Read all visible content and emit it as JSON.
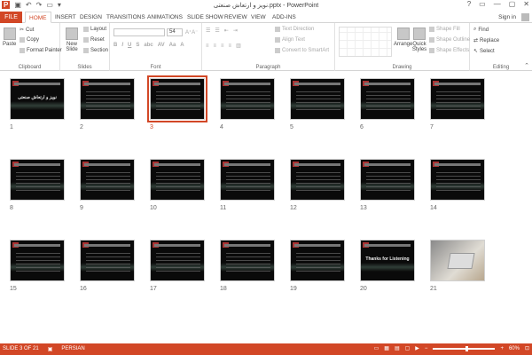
{
  "window": {
    "title": "نویز و ارتعاش صنعتی.pptx - PowerPoint",
    "controls": [
      "?",
      "▭",
      "—",
      "▢",
      "✕"
    ]
  },
  "tabs": {
    "file": "FILE",
    "items": [
      "HOME",
      "INSERT",
      "DESIGN",
      "TRANSITIONS",
      "ANIMATIONS",
      "SLIDE SHOW",
      "REVIEW",
      "VIEW",
      "ADD-INS"
    ],
    "active": "HOME",
    "signin": "Sign in"
  },
  "ribbon": {
    "clipboard": {
      "paste": "Paste",
      "cut": "Cut",
      "copy": "Copy",
      "format_painter": "Format Painter",
      "label": "Clipboard"
    },
    "slides": {
      "new_slide": "New Slide",
      "layout": "Layout",
      "reset": "Reset",
      "section": "Section",
      "label": "Slides"
    },
    "font": {
      "size": "54",
      "label": "Font",
      "bold": "B",
      "italic": "I",
      "underline": "U",
      "strike": "S",
      "shadow": "abc",
      "spacing": "AV",
      "case": "Aa",
      "color": "A"
    },
    "paragraph": {
      "text_direction": "Text Direction",
      "align_text": "Align Text",
      "smartart": "Convert to SmartArt",
      "label": "Paragraph"
    },
    "drawing": {
      "arrange": "Arrange",
      "quick_styles": "Quick Styles",
      "shape_fill": "Shape Fill",
      "shape_outline": "Shape Outline",
      "shape_effects": "Shape Effects",
      "label": "Drawing"
    },
    "editing": {
      "find": "Find",
      "replace": "Replace",
      "select": "Select",
      "label": "Editing"
    }
  },
  "slides": [
    {
      "n": "1",
      "title": "نویز و ارتعاش صنعتی"
    },
    {
      "n": "2"
    },
    {
      "n": "3"
    },
    {
      "n": "4"
    },
    {
      "n": "5"
    },
    {
      "n": "6"
    },
    {
      "n": "7"
    },
    {
      "n": "8"
    },
    {
      "n": "9"
    },
    {
      "n": "10"
    },
    {
      "n": "11"
    },
    {
      "n": "12"
    },
    {
      "n": "13"
    },
    {
      "n": "14"
    },
    {
      "n": "15"
    },
    {
      "n": "16"
    },
    {
      "n": "17"
    },
    {
      "n": "18"
    },
    {
      "n": "19"
    },
    {
      "n": "20",
      "title": "Thanks for Listening"
    },
    {
      "n": "21"
    }
  ],
  "selected_slide": "3",
  "status": {
    "slide_info": "SLIDE 3 OF 21",
    "language": "PERSIAN",
    "zoom": "60%",
    "zoom_minus": "−",
    "zoom_plus": "+",
    "zoom_level": 0.55
  },
  "colors": {
    "accent": "#d24726"
  }
}
